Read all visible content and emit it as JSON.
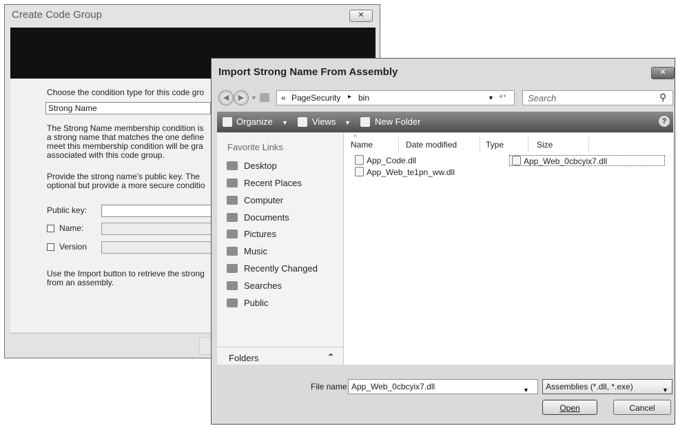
{
  "back_dialog": {
    "title": "Create Code Group",
    "close_symbol": "✕",
    "instruction": "Choose the condition type for this code gro",
    "condition_type": "Strong Name",
    "description_lines": [
      "The Strong Name membership condition is",
      "a strong name that matches the one define",
      "meet this membership condition will be gra",
      "associated with this code group."
    ],
    "provide_lines": [
      "Provide the strong name's public key.  The",
      "optional but provide a more secure conditio"
    ],
    "public_key_label": "Public key:",
    "name_label": "Name:",
    "version_label": "Version",
    "import_lines": [
      "Use the Import button to retrieve the strong",
      "from an assembly."
    ]
  },
  "dialog": {
    "title": "Import Strong Name From Assembly",
    "close_symbol": "✕",
    "address": {
      "chevrons": "«",
      "segments": [
        "PageSecurity",
        "bin"
      ],
      "separator": "▸"
    },
    "refresh_symbol": "⁴⁺",
    "search_placeholder": "Search",
    "toolbar": {
      "organize": "Organize",
      "views": "Views",
      "new_folder": "New Folder",
      "help": "?"
    },
    "favorite_links_heading": "Favorite Links",
    "favorite_links": [
      {
        "label": "Desktop",
        "icon": "desktop-icon"
      },
      {
        "label": "Recent Places",
        "icon": "recent-places-icon"
      },
      {
        "label": "Computer",
        "icon": "computer-icon"
      },
      {
        "label": "Documents",
        "icon": "documents-icon"
      },
      {
        "label": "Pictures",
        "icon": "pictures-icon"
      },
      {
        "label": "Music",
        "icon": "music-icon"
      },
      {
        "label": "Recently Changed",
        "icon": "recently-changed-icon"
      },
      {
        "label": "Searches",
        "icon": "searches-icon"
      },
      {
        "label": "Public",
        "icon": "public-icon"
      }
    ],
    "folders_label": "Folders",
    "columns": {
      "name": "Name",
      "date_modified": "Date modified",
      "type": "Type",
      "size": "Size"
    },
    "files": [
      "App_Code.dll",
      "App_Web_te1pn_ww.dll",
      "App_Web_0cbcyix7.dll"
    ],
    "file_name_label": "File name:",
    "file_name_value": "App_Web_0cbcyix7.dll",
    "file_type": "Assemblies (*.dll, *.exe)",
    "open_label": "Open",
    "cancel_label": "Cancel"
  }
}
